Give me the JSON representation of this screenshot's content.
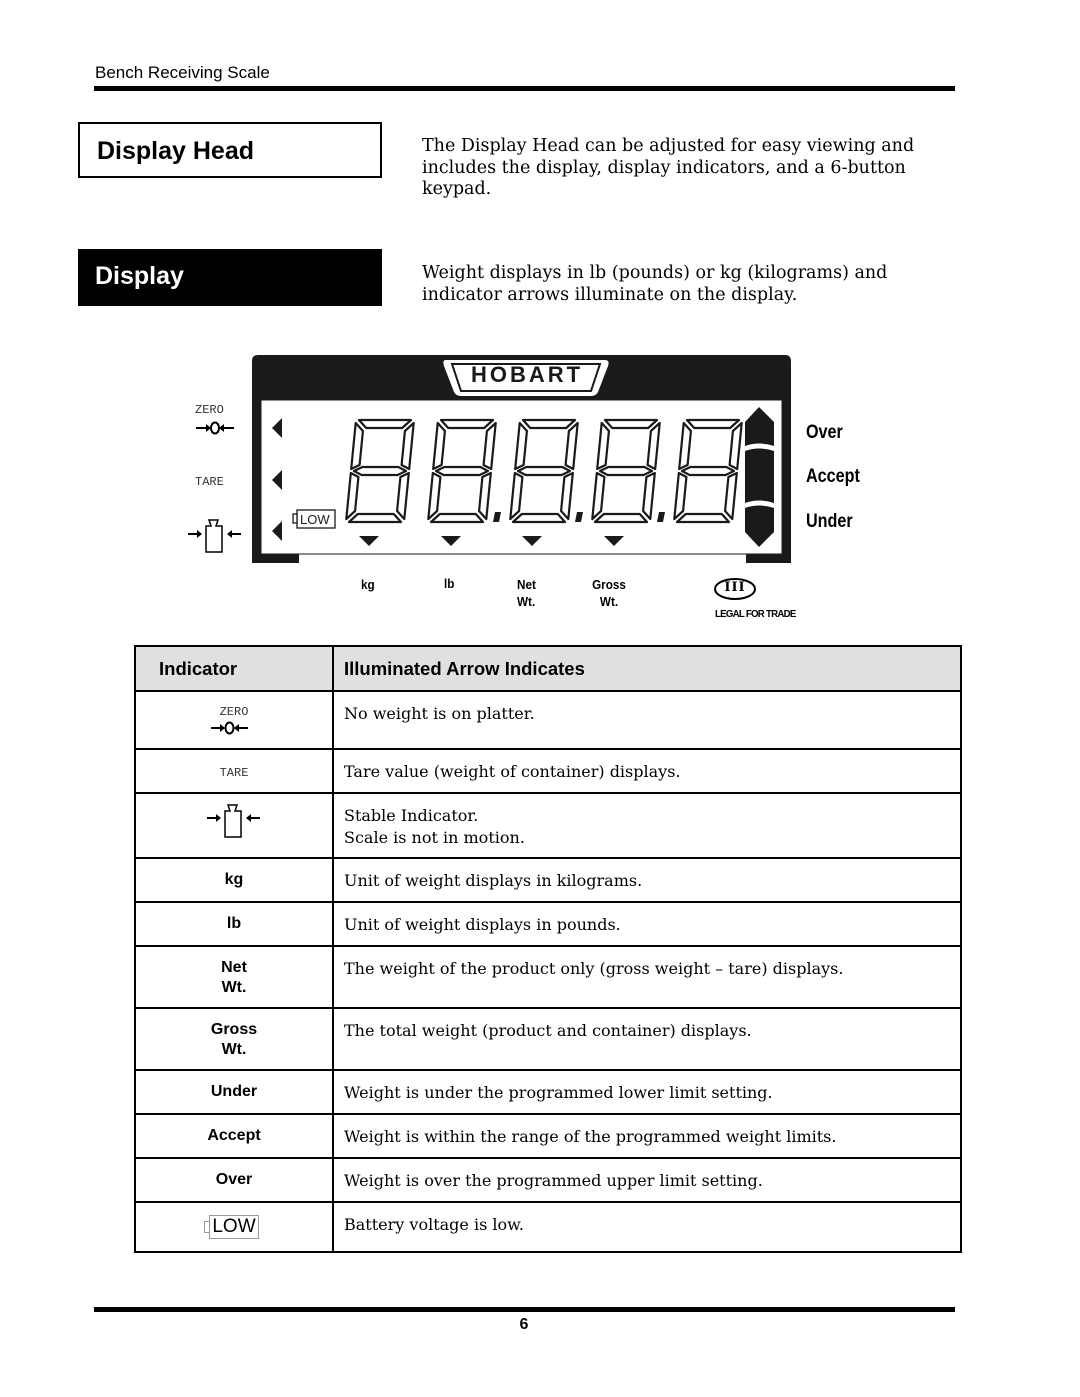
{
  "running_header": "Bench Receiving Scale",
  "sections": [
    {
      "title": "Display Head",
      "style": "outlined",
      "text": "The Display Head can be adjusted for easy viewing and includes the display, display indicators, and a 6-button keypad."
    },
    {
      "title": "Display",
      "style": "filled",
      "text": "Weight displays in lb (pounds) or kg (kilograms) and indicator arrows illuminate on the display."
    }
  ],
  "display_figure": {
    "brand": "HOBART",
    "digits": "88.8.8.8",
    "left_indicators": [
      {
        "label": "ZERO",
        "icon": "zero-center-icon"
      },
      {
        "label": "TARE",
        "icon": ""
      },
      {
        "label": "",
        "icon": "stable-weight-icon"
      }
    ],
    "low_battery_label": "LOW",
    "right_indicators": [
      "Over",
      "Accept",
      "Under"
    ],
    "bottom_indicators": [
      {
        "line1": "kg",
        "line2": ""
      },
      {
        "line1": "lb",
        "line2": ""
      },
      {
        "line1": "Net",
        "line2": "Wt."
      },
      {
        "line1": "Gross",
        "line2": "Wt."
      }
    ],
    "certification": {
      "class": "III",
      "caption": "LEGAL FOR TRADE"
    }
  },
  "table": {
    "headers": [
      "Indicator",
      "Illuminated Arrow Indicates"
    ],
    "rows": [
      {
        "indicator": "ZERO",
        "indicator_icon": "zero-center-icon",
        "description": "No weight is on platter."
      },
      {
        "indicator": "TARE",
        "indicator_icon": "",
        "description": "Tare value (weight of container) displays."
      },
      {
        "indicator": "",
        "indicator_icon": "stable-weight-icon",
        "description": "Stable Indicator.",
        "description_line2": "Scale is not in motion."
      },
      {
        "indicator": "kg",
        "description": "Unit of weight displays in kilograms."
      },
      {
        "indicator": "lb",
        "description": "Unit of weight displays in pounds."
      },
      {
        "indicator": "Net",
        "indicator_line2": "Wt.",
        "description": "The weight of the product only (gross weight – tare) displays."
      },
      {
        "indicator": "Gross",
        "indicator_line2": "Wt.",
        "description": "The total weight (product and container) displays."
      },
      {
        "indicator": "Under",
        "description": "Weight is under the programmed lower limit setting."
      },
      {
        "indicator": "Accept",
        "description": "Weight is within the range of the programmed weight limits."
      },
      {
        "indicator": "Over",
        "description": "Weight is over the programmed upper limit setting."
      },
      {
        "indicator": "LOW",
        "indicator_icon": "low-battery-icon",
        "description": "Battery voltage is low."
      }
    ]
  },
  "page_number": "6"
}
